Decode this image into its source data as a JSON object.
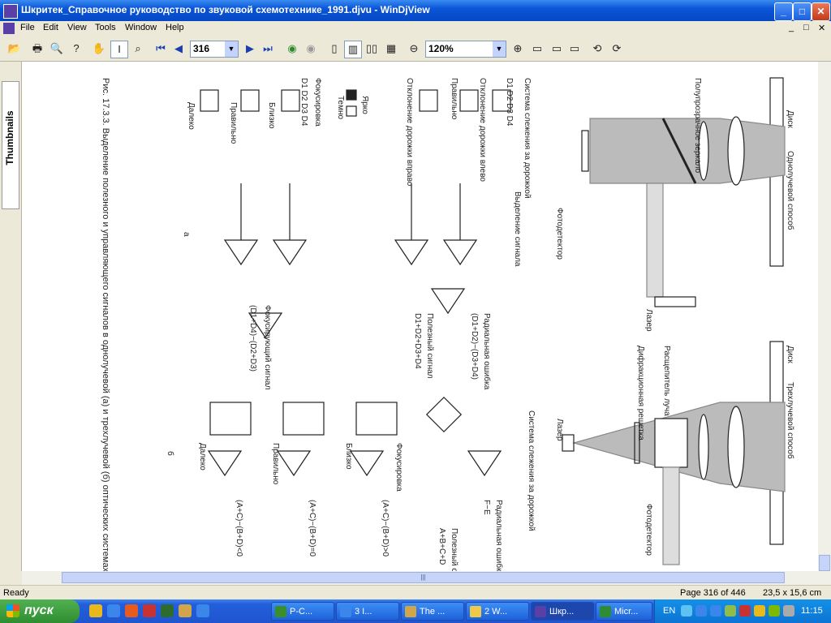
{
  "window": {
    "title": "Шкритек_Справочное руководство по звуковой схемотехнике_1991.djvu - WinDjView",
    "btn_min": "_",
    "btn_max": "□",
    "btn_close": "✕"
  },
  "menu": {
    "items": [
      "File",
      "Edit",
      "View",
      "Tools",
      "Window",
      "Help"
    ],
    "mdi_min": "_",
    "mdi_restore": "□",
    "mdi_close": "✕"
  },
  "toolbar": {
    "page_value": "316",
    "zoom_value": "120%"
  },
  "sidebar": {
    "tab_label": "Thumbnails"
  },
  "document": {
    "left": {
      "disk": "Диск",
      "title": "Однолучевой способ",
      "mirror": "Полупрозрачное зеркало",
      "laser": "Лазер",
      "photodetector": "Фотодетектор",
      "d_labels": [
        "D1",
        "D2",
        "D3",
        "D4"
      ],
      "tracking_title": "Система слежения за дорожкой",
      "tracking_cols": "D1 D2  D3 D4",
      "dev_left": "Отклонение дорожки влево",
      "correct": "Правильно",
      "dev_right": "Отклонение дорожки вправо",
      "bright": "Ярко",
      "dark": "Темно",
      "focus_title": "Фокусировка",
      "focus_cols": "D1 D2  D3 D4",
      "near": "Близко",
      "far": "Далеко",
      "signal_sel": "Выделение сигнала",
      "radial_err": "Радиальная ошибка",
      "radial_formula": "(D1+D2)−(D3+D4)",
      "useful": "Полезный сигнал",
      "useful_formula": "D1+D2+D3+D4",
      "focusing_sig": "Фокусирующий сигнал",
      "focusing_formula": "(D1+D4)−(D2+D3)",
      "fig_a": "а"
    },
    "right": {
      "disk": "Диск",
      "title": "Трехлучевой способ",
      "splitter": "Расщепитель луча",
      "grating": "Дифракционная решетка",
      "laser": "Лазер",
      "photodetector": "Фотодетектор",
      "tracking_title": "Система слежения за дорожкой",
      "radial_err": "Радиальная ошибка",
      "radial_formula": "F−E",
      "useful": "Полезный сигнал",
      "useful_formula": "A+B+C+D",
      "focus_title": "Фокусировка",
      "near": "Близко",
      "correct": "Правильно",
      "far": "Далеко",
      "formula_near": "(A+C)−(B+D)>0",
      "formula_correct": "(A+C)−(B+D)=0",
      "formula_far": "(A+C)−(B+D)<0",
      "fig_b": "б"
    },
    "caption": "Рис. 17.3.3. Выделение полезного и управляющего сигналов в однолучевой (а) и трехлучевой (б) оптических системах [17.8]."
  },
  "status": {
    "ready": "Ready",
    "page_info": "Page 316 of 446",
    "size_info": "23,5 x 15,6 cm"
  },
  "taskbar": {
    "start": "пуск",
    "tasks": [
      "P-C...",
      "3 I...",
      "The ...",
      "2 W...",
      "Шкр...",
      "Micr..."
    ],
    "lang": "EN",
    "clock": "11:15"
  }
}
